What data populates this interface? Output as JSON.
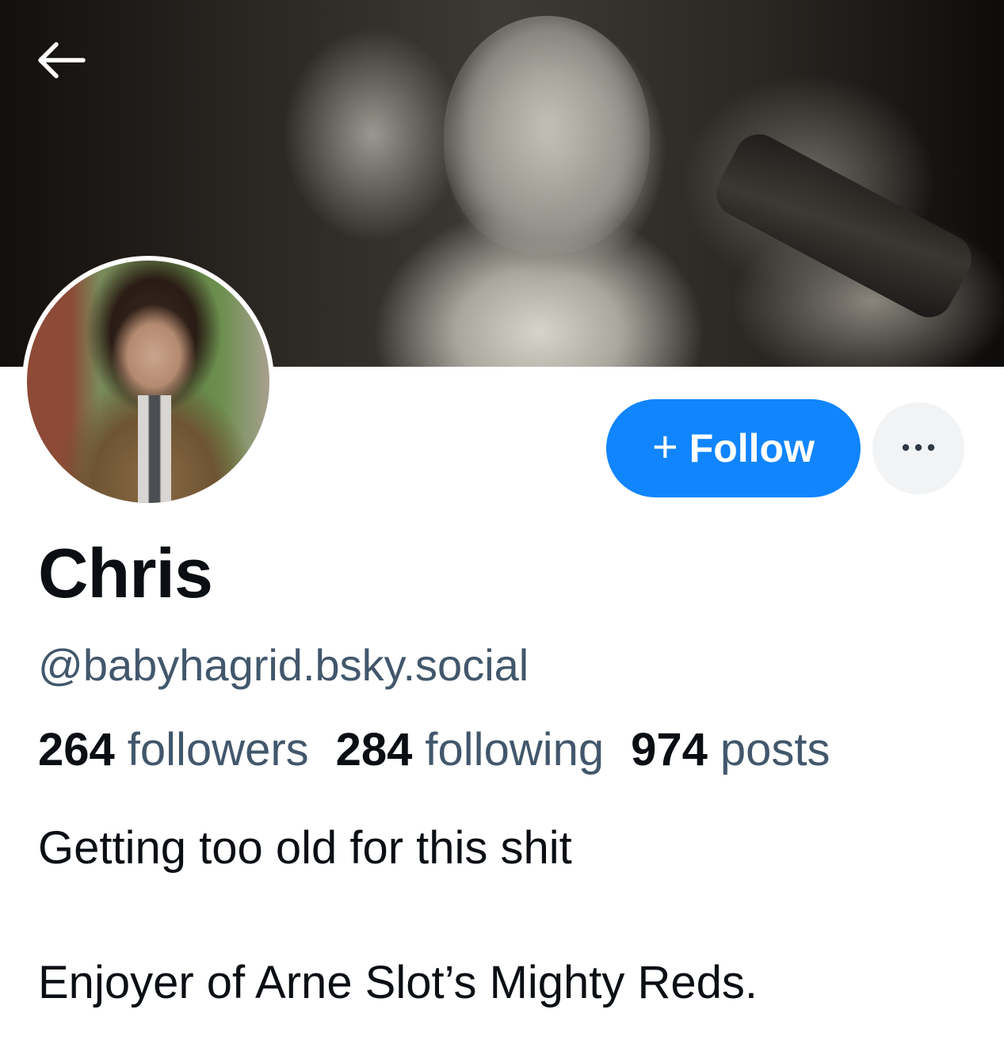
{
  "header": {
    "back_icon": "arrow-left-icon"
  },
  "profile": {
    "display_name": "Chris",
    "handle": "@babyhagrid.bsky.social",
    "follow_label": "Follow",
    "follow_icon": "plus-icon",
    "more_icon": "ellipsis-icon",
    "accent_color": "#1185fe",
    "stats": {
      "followers_count": "264",
      "followers_label": "followers",
      "following_count": "284",
      "following_label": "following",
      "posts_count": "974",
      "posts_label": "posts"
    },
    "bio": {
      "line1": "Getting too old for this shit",
      "line2": "Enjoyer of Arne Slot’s Mighty Reds."
    }
  }
}
